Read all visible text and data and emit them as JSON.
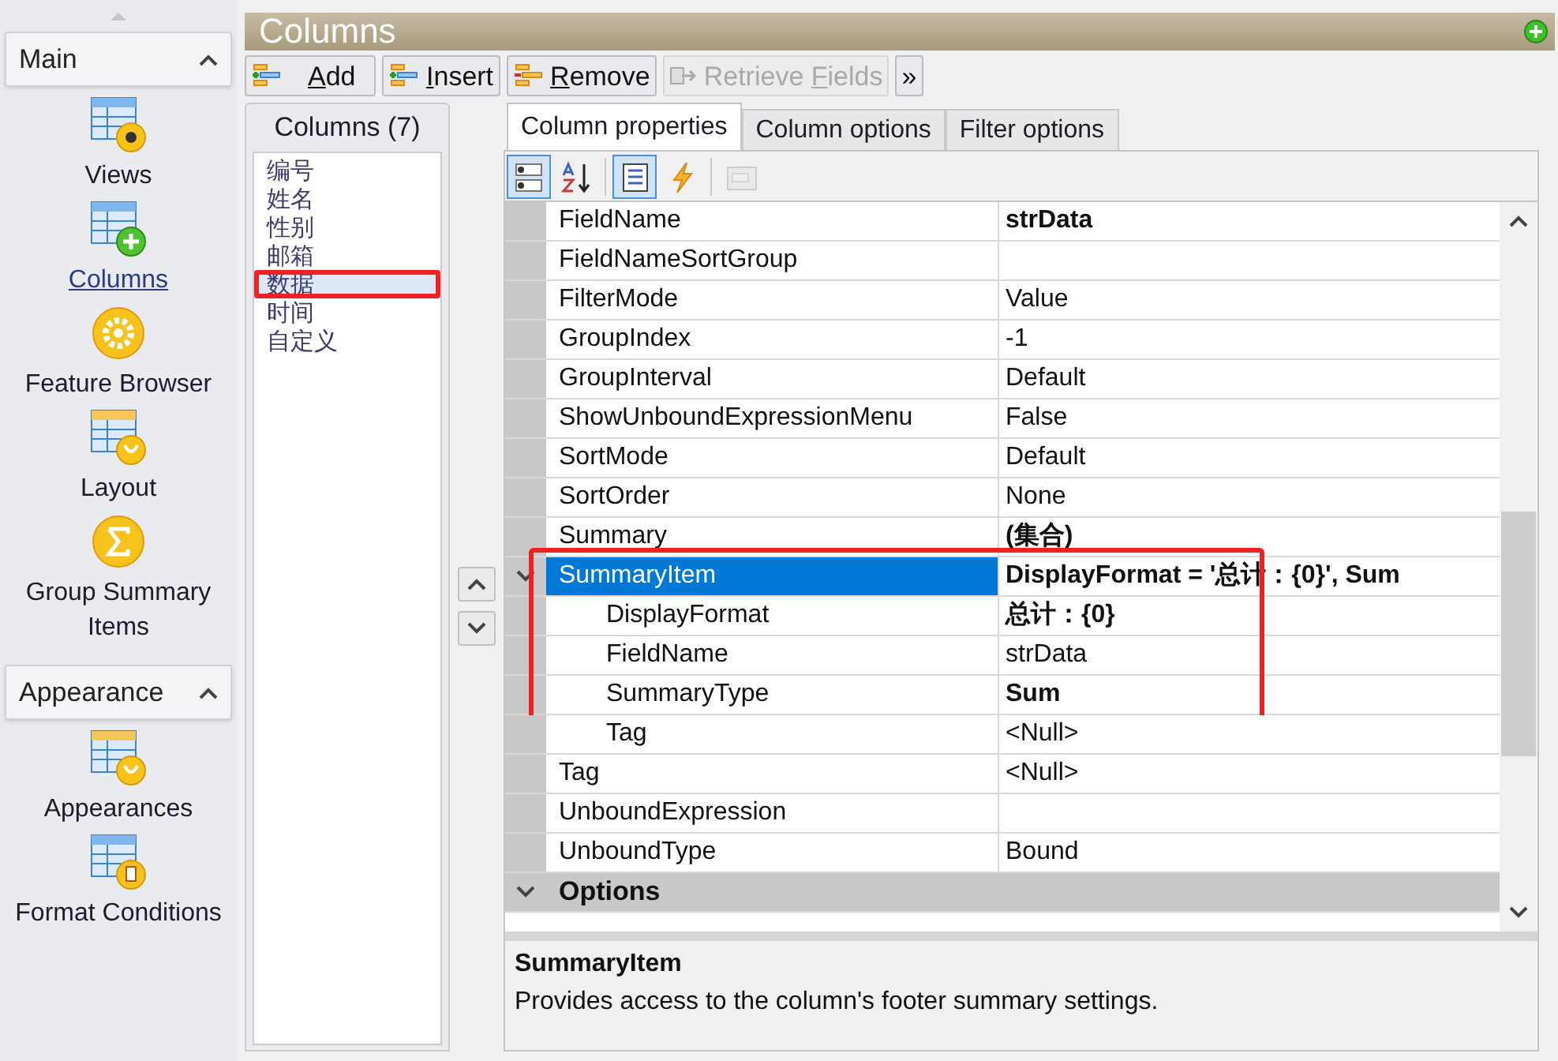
{
  "sidebar": {
    "groups": [
      {
        "title": "Main",
        "expanded": true,
        "items": [
          {
            "label": "Views",
            "selected": false
          },
          {
            "label": "Columns",
            "selected": true
          },
          {
            "label": "Feature Browser",
            "selected": false
          },
          {
            "label": "Layout",
            "selected": false
          },
          {
            "label": "Group Summary Items",
            "selected": false
          }
        ]
      },
      {
        "title": "Appearance",
        "expanded": true,
        "items": [
          {
            "label": "Appearances",
            "selected": false
          },
          {
            "label": "Format Conditions",
            "selected": false
          }
        ]
      }
    ]
  },
  "window": {
    "title": "Columns"
  },
  "toolbar": [
    {
      "shortcut": "A",
      "label_after": "dd",
      "disabled": false
    },
    {
      "shortcut": "I",
      "label_after": "nsert",
      "disabled": false
    },
    {
      "shortcut": "R",
      "label_after": "emove",
      "disabled": false
    },
    {
      "label_before": "Retrieve ",
      "shortcut": "F",
      "label_after": "ields",
      "disabled": true
    },
    {
      "label": "»",
      "disabled": false
    }
  ],
  "columns_list": {
    "title": "Columns (7)",
    "items": [
      {
        "label": "编号",
        "selected": false,
        "highlighted": false
      },
      {
        "label": "姓名",
        "selected": false,
        "highlighted": false
      },
      {
        "label": "性别",
        "selected": false,
        "highlighted": false
      },
      {
        "label": "邮箱",
        "selected": false,
        "highlighted": false
      },
      {
        "label": "数据",
        "selected": true,
        "highlighted": true
      },
      {
        "label": "时间",
        "selected": false,
        "highlighted": false
      },
      {
        "label": "自定义",
        "selected": false,
        "highlighted": false
      }
    ]
  },
  "tabs": [
    {
      "label": "Column properties",
      "selected": true
    },
    {
      "label": "Column options",
      "selected": false
    },
    {
      "label": "Filter options",
      "selected": false
    }
  ],
  "grid_toolbar": [
    {
      "selected": true,
      "disabled": false
    },
    {
      "selected": false,
      "disabled": false
    },
    {
      "selected": true,
      "disabled": false
    },
    {
      "selected": false,
      "disabled": false
    },
    {
      "selected": false,
      "disabled": true
    }
  ],
  "properties": [
    {
      "kind": "property",
      "name": "FieldName",
      "value": "strData",
      "bold": true,
      "selected": false
    },
    {
      "kind": "property",
      "name": "FieldNameSortGroup",
      "selected": false
    },
    {
      "kind": "property",
      "name": "FilterMode",
      "value": "Value",
      "bold": false,
      "selected": false
    },
    {
      "kind": "property",
      "name": "GroupIndex",
      "value": "-1",
      "bold": false,
      "selected": false
    },
    {
      "kind": "property",
      "name": "GroupInterval",
      "value": "Default",
      "bold": false,
      "selected": false
    },
    {
      "kind": "property",
      "name": "ShowUnboundExpressionMenu",
      "value": "False",
      "bold": false,
      "selected": false
    },
    {
      "kind": "property",
      "name": "SortMode",
      "value": "Default",
      "bold": false,
      "selected": false
    },
    {
      "kind": "property",
      "name": "SortOrder",
      "value": "None",
      "bold": false,
      "selected": false
    },
    {
      "kind": "property",
      "name": "Summary",
      "value": "(集合)",
      "bold": true,
      "selected": false
    },
    {
      "kind": "property",
      "name": "SummaryItem",
      "value": "DisplayFormat = '总计：{0}', Sum",
      "bold": true,
      "selected": true,
      "highlighted": true,
      "expanded": true,
      "children": [
        {
          "kind": "property",
          "name": "DisplayFormat",
          "value": "总计：{0}",
          "bold": true,
          "selected": false,
          "highlighted": true
        },
        {
          "kind": "property",
          "name": "FieldName",
          "value": "strData",
          "bold": false,
          "selected": false,
          "highlighted": true
        },
        {
          "kind": "property",
          "name": "SummaryType",
          "value": "Sum",
          "bold": true,
          "selected": false,
          "highlighted": true
        },
        {
          "kind": "property",
          "name": "Tag",
          "value": "<Null>",
          "bold": false,
          "selected": false
        }
      ]
    },
    {
      "kind": "property",
      "name": "Tag",
      "value": "<Null>",
      "bold": false,
      "selected": false
    },
    {
      "kind": "property",
      "name": "UnboundExpression",
      "selected": false
    },
    {
      "kind": "property",
      "name": "UnboundType",
      "value": "Bound",
      "bold": false,
      "selected": false
    },
    {
      "kind": "category",
      "name": "Options",
      "expanded": true
    }
  ],
  "description": {
    "title": "SummaryItem",
    "text": "Provides access to the column's footer summary settings."
  }
}
